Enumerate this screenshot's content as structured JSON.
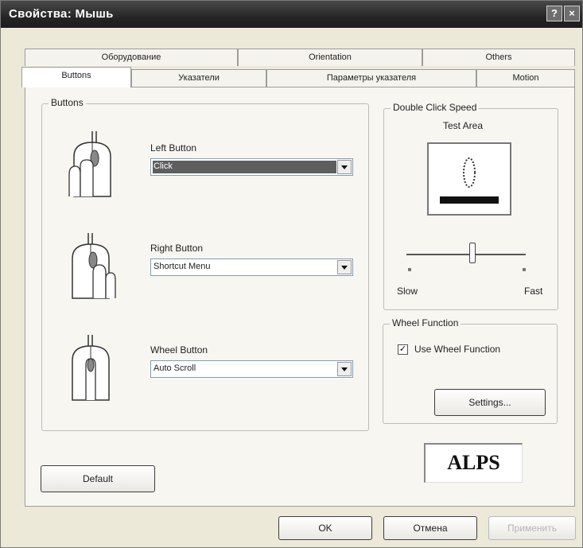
{
  "window": {
    "title": "Свойства: Мышь",
    "help_glyph": "?",
    "close_glyph": "×"
  },
  "tabs_row1": [
    "Оборудование",
    "Orientation",
    "Others"
  ],
  "tabs_row2": [
    "Buttons",
    "Указатели",
    "Параметры указателя",
    "Motion"
  ],
  "buttons_group": {
    "label": "Buttons",
    "left": {
      "label": "Left Button",
      "value": "Click"
    },
    "right": {
      "label": "Right Button",
      "value": "Shortcut Menu"
    },
    "wheel": {
      "label": "Wheel Button",
      "value": "Auto Scroll"
    }
  },
  "double_click": {
    "label": "Double Click Speed",
    "test_area": "Test Area",
    "slow": "Slow",
    "fast": "Fast",
    "speed_level": 0.55
  },
  "wheel_function": {
    "label": "Wheel Function",
    "checkbox_label": "Use Wheel Function",
    "checked": true,
    "settings_button": "Settings..."
  },
  "logo": "ALPS",
  "default_button": "Default",
  "footer": {
    "ok": "OK",
    "cancel": "Отмена",
    "apply": "Применить"
  },
  "colors": {
    "titlebar": "#262626",
    "selection": "#5e5e5e"
  }
}
